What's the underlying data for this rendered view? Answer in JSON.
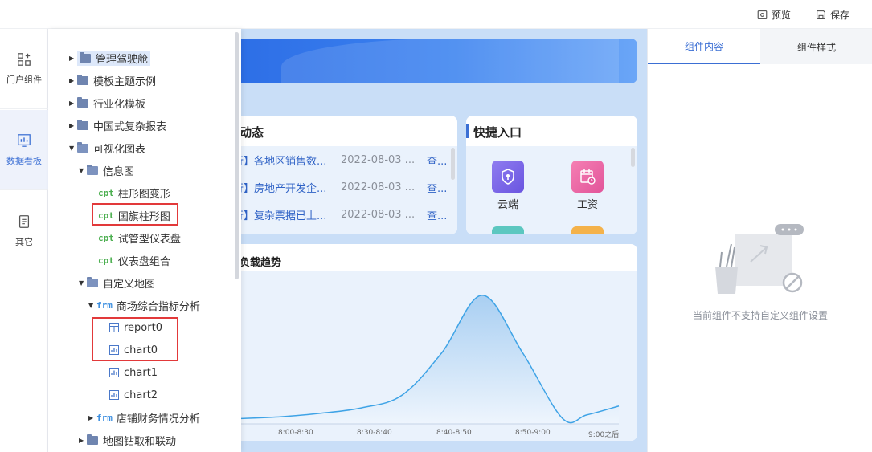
{
  "topbar": {
    "preview_label": "预览",
    "save_label": "保存"
  },
  "rail": {
    "items": [
      {
        "label": "门户组件",
        "icon": "component-grid-icon"
      },
      {
        "label": "数据看板",
        "icon": "bar-chart-board-icon"
      },
      {
        "label": "其它",
        "icon": "document-icon"
      }
    ]
  },
  "tree": {
    "nodes": [
      "管理驾驶舱",
      "模板主题示例",
      "行业化模板",
      "中国式复杂报表",
      "可视化图表",
      "信息图",
      "柱形图变形",
      "国旗柱形图",
      "试管型仪表盘",
      "仪表盘组合",
      "自定义地图",
      "商场综合指标分析",
      "report0",
      "chart0",
      "chart1",
      "chart2",
      "店铺财务情况分析",
      "地图钻取和联动"
    ],
    "tag_cpt": "cpt",
    "tag_frm": "frm"
  },
  "dynamics": {
    "title": "动态",
    "rows": [
      {
        "title": "行】各地区销售数...",
        "date": "2022-08-03 ...",
        "more": "查..."
      },
      {
        "title": "行】房地产开发企...",
        "date": "2022-08-03 ...",
        "more": "查..."
      },
      {
        "title": "行】复杂票据已上...",
        "date": "2022-08-03 ...",
        "more": "查..."
      }
    ]
  },
  "quick": {
    "title": "快捷入口",
    "items": [
      {
        "label": "云端"
      },
      {
        "label": "工资"
      }
    ]
  },
  "trend": {
    "title": "负载趋势"
  },
  "chart_data": {
    "type": "area",
    "categories": [
      "8:00-8:30",
      "8:30-8:40",
      "8:40-8:50",
      "8:50-9:00",
      "9:00之后"
    ],
    "x_ticks": [
      "8:00-8:30",
      "8:30-8:40",
      "8:40-8:50",
      "8:50-9:00",
      "9:00之后"
    ],
    "x": [
      0,
      0.5,
      1,
      1.5,
      2,
      2.5,
      3,
      3.5,
      4,
      4.3,
      4.7
    ],
    "y": [
      3,
      4,
      6,
      9,
      16,
      40,
      72,
      40,
      3,
      5,
      10
    ],
    "ylim": [
      0,
      80
    ],
    "title": "负载趋势",
    "grid": false,
    "colors": {
      "line": "#3ea3e6",
      "fill_top": "#a9cff2",
      "fill_bottom": "#eef5fd"
    }
  },
  "right_panel": {
    "tabs": [
      "组件内容",
      "组件样式"
    ],
    "empty_text": "当前组件不支持自定义组件设置"
  }
}
